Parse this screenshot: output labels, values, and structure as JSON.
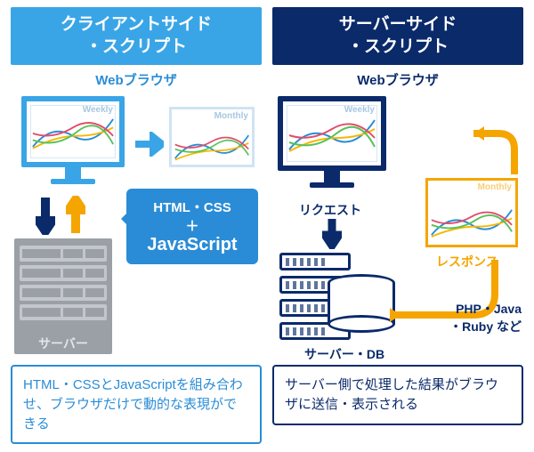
{
  "left": {
    "title_line1": "クライアントサイド",
    "title_line2": "・スクリプト",
    "browser_label": "Webブラウザ",
    "chart_weekly": "Weekly",
    "chart_monthly": "Monthly",
    "callout_l1": "HTML・CSS",
    "callout_plus": "＋",
    "callout_js": "JavaScript",
    "server_label": "サーバー",
    "caption": "HTML・CSSとJavaScriptを組み合わせ、ブラウザだけで動的な表現ができる"
  },
  "right": {
    "title_line1": "サーバーサイド",
    "title_line2": "・スクリプト",
    "browser_label": "Webブラウザ",
    "chart_weekly": "Weekly",
    "chart_monthly": "Monthly",
    "request_label": "リクエスト",
    "response_label": "レスポンス",
    "server_db_label": "サーバー・DB",
    "lang_l1": "PHP・Java",
    "lang_l2": "・Ruby など",
    "caption": "サーバー側で処理した結果がブラウザに送信・表示される"
  }
}
